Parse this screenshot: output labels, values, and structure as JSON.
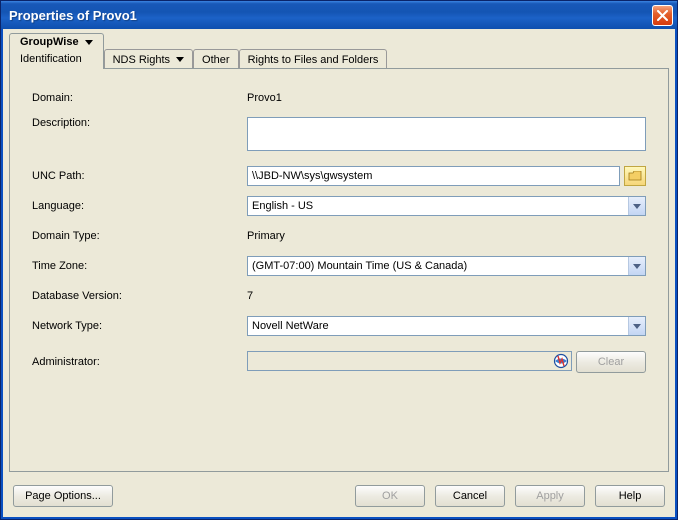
{
  "window": {
    "title": "Properties of Provo1"
  },
  "tabs": {
    "groupwise": {
      "label": "GroupWise",
      "sublabel": "Identification"
    },
    "nds_rights": {
      "label": "NDS Rights"
    },
    "other": {
      "label": "Other"
    },
    "rights_files": {
      "label": "Rights to Files and Folders"
    }
  },
  "form": {
    "domain": {
      "label": "Domain:",
      "value": "Provo1"
    },
    "description": {
      "label": "Description:",
      "value": ""
    },
    "unc_path": {
      "label": "UNC Path:",
      "value": "\\\\JBD-NW\\sys\\gwsystem"
    },
    "language": {
      "label": "Language:",
      "value": "English - US"
    },
    "domain_type": {
      "label": "Domain Type:",
      "value": "Primary"
    },
    "time_zone": {
      "label": "Time Zone:",
      "value": "(GMT-07:00) Mountain Time (US & Canada)"
    },
    "db_version": {
      "label": "Database Version:",
      "value": "7"
    },
    "network_type": {
      "label": "Network Type:",
      "value": "Novell NetWare"
    },
    "administrator": {
      "label": "Administrator:",
      "value": "",
      "clear_label": "Clear"
    }
  },
  "footer": {
    "page_options": "Page Options...",
    "ok": "OK",
    "cancel": "Cancel",
    "apply": "Apply",
    "help": "Help"
  }
}
